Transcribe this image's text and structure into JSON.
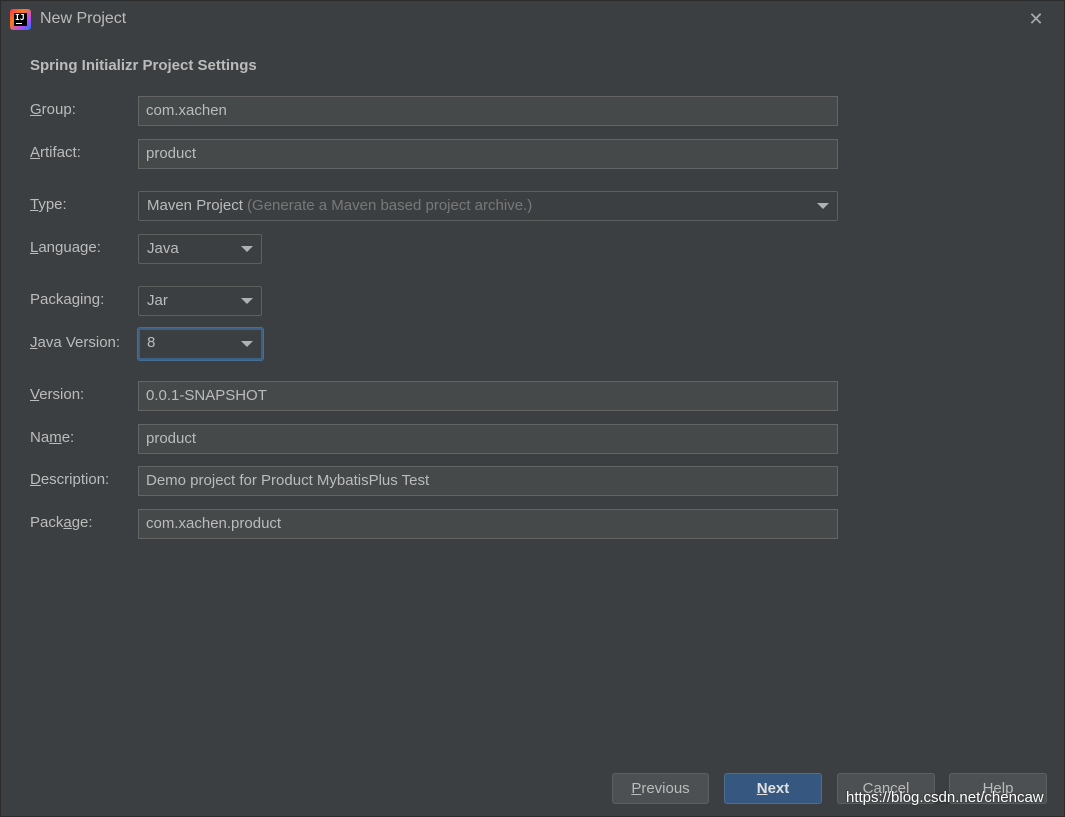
{
  "window": {
    "title": "New Project",
    "close_glyph": "✕",
    "app_icon": "intellij-idea-icon",
    "app_icon_text": "IJ"
  },
  "section_title": "Spring Initializr Project Settings",
  "fields": {
    "group": {
      "label_u": "G",
      "label_rest": "roup:",
      "value": "com.xachen"
    },
    "artifact": {
      "label_u": "A",
      "label_rest": "rtifact:",
      "value": "product"
    },
    "type": {
      "label_u": "T",
      "label_rest": "ype:",
      "value": "Maven Project",
      "hint": "(Generate a Maven based project archive.)"
    },
    "language": {
      "label_u": "L",
      "label_rest": "anguage:",
      "value": "Java"
    },
    "packaging": {
      "label_pre": "Packa",
      "label_u": "g",
      "label_rest": "ing:",
      "value": "Jar"
    },
    "java_version": {
      "label_u": "J",
      "label_rest": "ava Version:",
      "value": "8"
    },
    "version": {
      "label_u": "V",
      "label_rest": "ersion:",
      "value": "0.0.1-SNAPSHOT"
    },
    "name": {
      "label_pre": "Na",
      "label_u": "m",
      "label_rest": "e:",
      "value": "product"
    },
    "description": {
      "label_u": "D",
      "label_rest": "escription:",
      "value": "Demo project for Product MybatisPlus Test"
    },
    "package": {
      "label_pre": "Pack",
      "label_u": "a",
      "label_rest": "ge:",
      "value": "com.xachen.product"
    }
  },
  "buttons": {
    "previous": {
      "u": "P",
      "rest": "revious"
    },
    "next": {
      "u": "N",
      "rest": "ext"
    },
    "cancel": {
      "label": "Cancel"
    },
    "help": {
      "label": "Help"
    }
  },
  "watermark": "https://blog.csdn.net/chencaw",
  "colors": {
    "background": "#3c3f41",
    "field_background": "#45494a",
    "default_button": "#365880",
    "focus_ring": "#3d6185"
  }
}
